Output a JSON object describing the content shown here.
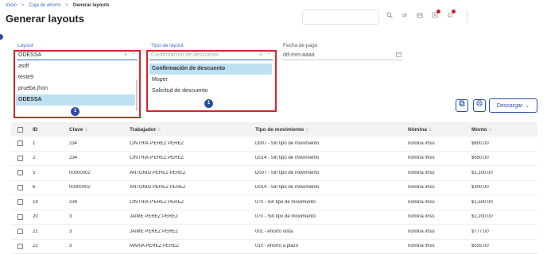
{
  "breadcrumb": {
    "items": [
      "Inicio",
      "Caja de ahorro",
      "Generar layouts"
    ],
    "separator": ">"
  },
  "page_title": "Generar layouts",
  "toolbar": {
    "icons": [
      "search-icon",
      "refresh-icon",
      "tools-icon",
      "notifications-icon",
      "bell-icon"
    ]
  },
  "filters": {
    "layout": {
      "label": "Layout",
      "value": "ODESSA",
      "options": [
        "asdf",
        "teste9",
        "prueba jhon",
        "ODESSA"
      ],
      "selected": "ODESSA",
      "badge": "1"
    },
    "tipo_layout": {
      "label": "Tipo de layout",
      "placeholder": "Confirmación de descuento",
      "options": [
        "Confirmación de descuento",
        "Moper",
        "Solicitud de descuento"
      ],
      "highlighted": "Confirmación de descuento",
      "badge": "1"
    },
    "fecha_pago": {
      "label": "Fecha de pago",
      "placeholder": "dd-mm-aaaa"
    }
  },
  "actions": {
    "download_label": "Descargar"
  },
  "table": {
    "columns": [
      "ID",
      "Clave",
      "Trabajador",
      "Tipo de movimiento",
      "Nómina",
      "Monto"
    ],
    "rows": [
      {
        "id": "1",
        "clave": "234",
        "trabajador": "CINTHIA P'EREZ PEREZ",
        "movimiento": "D007 - Sin tipo de movimiento",
        "nomina": "nomina imss",
        "monto": "$600.00"
      },
      {
        "id": "2",
        "clave": "234",
        "trabajador": "CINTHIA P'EREZ PEREZ",
        "movimiento": "D014 - Sin tipo de movimiento",
        "nomina": "nomina imss",
        "monto": "$650.00"
      },
      {
        "id": "5",
        "clave": "00000002",
        "trabajador": "ANTOÑIO PEREZ PEREZ",
        "movimiento": "D007 - Sin tipo de movimiento",
        "nomina": "nomina imss",
        "monto": "$1,100.00"
      },
      {
        "id": "6",
        "clave": "00000002",
        "trabajador": "ANTOÑIO PEREZ PEREZ",
        "movimiento": "D014 - Sin tipo de movimiento",
        "nomina": "nomina imss",
        "monto": "$300.00"
      },
      {
        "id": "19",
        "clave": "234",
        "trabajador": "CINTHIA P'EREZ PEREZ",
        "movimiento": "070 - Sin tipo de movimiento",
        "nomina": "nomina imss",
        "monto": "$1,500.00"
      },
      {
        "id": "20",
        "clave": "3",
        "trabajador": "JAIME PEREZ PEREZ",
        "movimiento": "070 - Sin tipo de movimiento",
        "nomina": "nomina imss",
        "monto": "$1,200.00"
      },
      {
        "id": "21",
        "clave": "3",
        "trabajador": "JAIME PEREZ PEREZ",
        "movimiento": "001 - Ahorro vista",
        "nomina": "nomina imss",
        "monto": "$777.00"
      },
      {
        "id": "22",
        "clave": "3",
        "trabajador": "MARIA PEREZ PEREZ",
        "movimiento": "010 - Ahorro a plazo",
        "nomina": "nomina imss",
        "monto": "$555.00"
      }
    ]
  },
  "colors": {
    "accent": "#2a4fa0",
    "link": "#3a6ec4",
    "highlight_box": "#d8232a",
    "selected_option": "#bfe0f2",
    "notification_dot": "#d21f2c"
  }
}
